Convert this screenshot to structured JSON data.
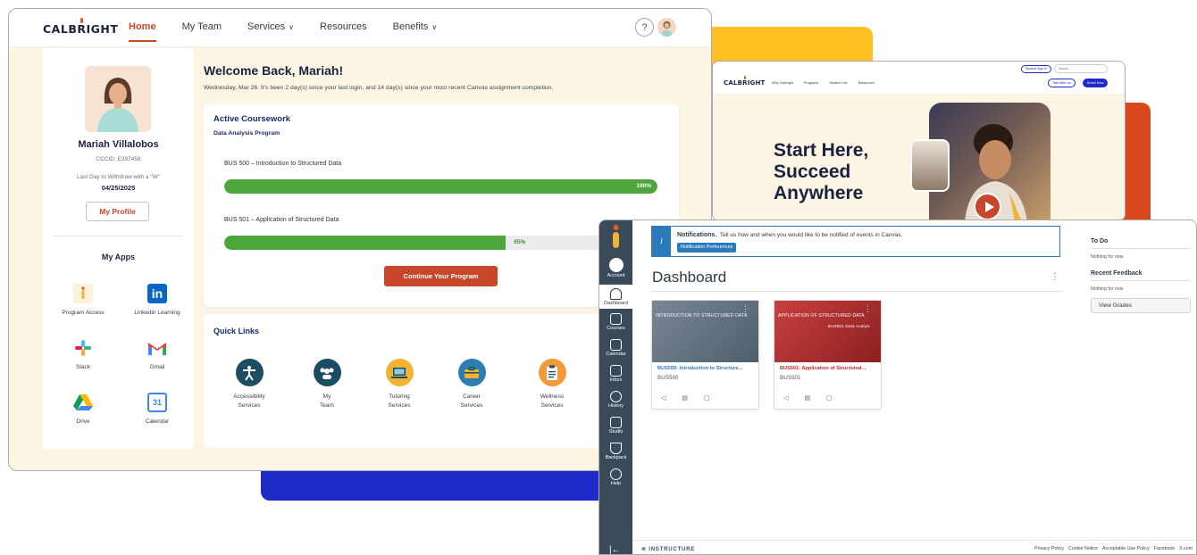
{
  "colors": {
    "accent_orange": "#c8462a",
    "progress_green": "#4ea53b",
    "brand_navy": "#1a2240",
    "brand_blue": "#1f2bc7",
    "brand_yellow": "#ffc024",
    "canvas_sidebar": "#394b58",
    "canvas_info": "#2b7abc",
    "course1_card": "#5c6d7c",
    "course2_card": "#b83232"
  },
  "portal": {
    "logo": "CALBRIGHT",
    "nav": [
      {
        "label": "Home",
        "active": true
      },
      {
        "label": "My Team",
        "active": false
      },
      {
        "label": "Services",
        "active": false,
        "icon": "chevron-down-icon"
      },
      {
        "label": "Resources",
        "active": false
      },
      {
        "label": "Benefits",
        "active": false,
        "icon": "chevron-down-icon"
      }
    ],
    "help_label": "?",
    "profile": {
      "name": "Mariah Villalobos",
      "ccid": "CCCID: E397458",
      "withdraw_label": "Last Day to Withdraw with a \"W\"",
      "withdraw_date": "04/25/2025",
      "button": "My Profile"
    },
    "apps": {
      "title": "My Apps",
      "items": [
        {
          "label": "Program Access",
          "icon": "calbright-icon"
        },
        {
          "label": "Linkedin Learning",
          "icon": "linkedin-icon"
        },
        {
          "label": "Slack",
          "icon": "slack-icon"
        },
        {
          "label": "Gmail",
          "icon": "gmail-icon"
        },
        {
          "label": "Drive",
          "icon": "drive-icon"
        },
        {
          "label": "Calendar",
          "icon": "calendar-icon",
          "glyph": "31"
        }
      ]
    },
    "welcome": {
      "title": "Welcome Back, Mariah!",
      "subtitle": "Wednesday, Mar 26. It's been 2 day(s) since your last login, and 14 day(s) since your most recent Canvas assignment completion."
    },
    "coursework": {
      "title": "Active Coursework",
      "program": "Data Analysis Program",
      "courses": [
        {
          "name": "BUS 500 – Introduction to Structured Data",
          "progress": 100,
          "progress_label": "100%"
        },
        {
          "name": "BUS 501 – Application of Structured Data",
          "progress": 65,
          "progress_label": "65%"
        }
      ],
      "button": "Continue Your Program"
    },
    "quick_links": {
      "title": "Quick Links",
      "items": [
        {
          "line1": "Accessibility",
          "line2": "Services",
          "icon": "accessibility-icon",
          "color": "#1d4d63"
        },
        {
          "line1": "My",
          "line2": "Team",
          "icon": "team-icon",
          "color": "#1d4d63"
        },
        {
          "line1": "Tutoring",
          "line2": "Services",
          "icon": "laptop-icon",
          "color": "#f2b233"
        },
        {
          "line1": "Career",
          "line2": "Services",
          "icon": "briefcase-icon",
          "color": "#2a7fb0"
        },
        {
          "line1": "Wellness",
          "line2": "Services",
          "icon": "clipboard-icon",
          "color": "#f29a38"
        }
      ]
    }
  },
  "website": {
    "logo": "CALBRIGHT",
    "student_signin": "Student Sign In",
    "search_placeholder": "Search...",
    "nav": [
      "Why Calbright",
      "Programs",
      "Student Life",
      "Newsroom"
    ],
    "talk_button": "Talk With Us",
    "enroll_button": "Enroll Now",
    "hero_lines": [
      "Start Here,",
      "Succeed",
      "Anywhere"
    ]
  },
  "canvas": {
    "sidebar": [
      {
        "label": "Account",
        "icon": "account-icon",
        "active": false
      },
      {
        "label": "Dashboard",
        "icon": "dashboard-icon",
        "active": true
      },
      {
        "label": "Courses",
        "icon": "courses-icon",
        "active": false
      },
      {
        "label": "Calendar",
        "icon": "calendar-icon",
        "active": false
      },
      {
        "label": "Inbox",
        "icon": "inbox-icon",
        "active": false
      },
      {
        "label": "History",
        "icon": "history-icon",
        "active": false
      },
      {
        "label": "Studio",
        "icon": "studio-icon",
        "active": false
      },
      {
        "label": "Backpack",
        "icon": "trophy-icon",
        "active": false
      },
      {
        "label": "Help",
        "icon": "help-icon",
        "active": false
      }
    ],
    "collapse_glyph": "|←",
    "notification": {
      "title": "Notifications.",
      "text": "Tell us how and when you would like to be notified of events in Canvas.",
      "button": "Notification Preferences"
    },
    "title": "Dashboard",
    "kebab": "⋮",
    "courses": [
      {
        "image_title": "INTRODUCTION TO STRUCTURED DATA",
        "name": "BUS500: Introduction to Structure...",
        "code": "BUS500",
        "color": "#5c6d7c",
        "name_color": "#2b7abc"
      },
      {
        "image_title": "APPLICATION OF STRUCTURED DATA",
        "image_sub": "BUS501 Data Analysi",
        "name": "BUS501: Application of Structured...",
        "code": "BUS501",
        "color": "#b83232",
        "name_color": "#c42b2b"
      }
    ],
    "todo": {
      "title": "To Do",
      "todo_text": "Nothing for now",
      "feedback_title": "Recent Feedback",
      "feedback_text": "Nothing for now",
      "grades_button": "View Grades"
    },
    "footer": {
      "brand": "INSTRUCTURE",
      "links": [
        "Privacy Policy",
        "Cookie Notice",
        "Acceptable Use Policy",
        "Facebook",
        "X.com"
      ]
    }
  }
}
